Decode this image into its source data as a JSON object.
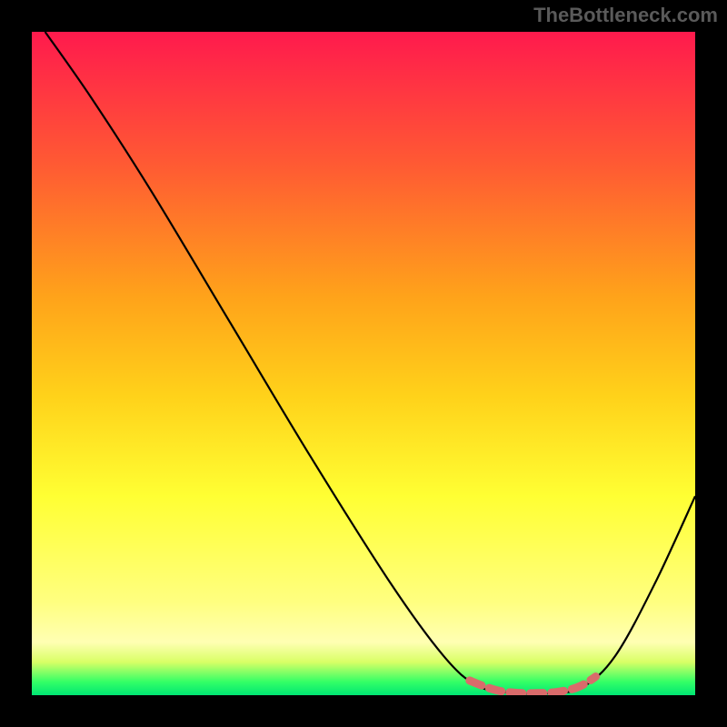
{
  "watermark": "TheBottleneck.com",
  "chart_data": {
    "type": "line",
    "title": "",
    "xlabel": "",
    "ylabel": "",
    "xlim": [
      0,
      100
    ],
    "ylim": [
      0,
      100
    ],
    "gradient_stops": [
      {
        "offset": 0,
        "color": "#ff1a4d"
      },
      {
        "offset": 20,
        "color": "#ff5a33"
      },
      {
        "offset": 40,
        "color": "#ffa31a"
      },
      {
        "offset": 55,
        "color": "#ffd21a"
      },
      {
        "offset": 70,
        "color": "#ffff33"
      },
      {
        "offset": 86,
        "color": "#ffff80"
      },
      {
        "offset": 92,
        "color": "#ffffb3"
      },
      {
        "offset": 95,
        "color": "#d9ff66"
      },
      {
        "offset": 98,
        "color": "#33ff66"
      },
      {
        "offset": 100,
        "color": "#00e673"
      }
    ],
    "series": [
      {
        "name": "bottleneck-curve",
        "color": "#000000",
        "points": [
          {
            "x": 2,
            "y": 100
          },
          {
            "x": 9,
            "y": 90
          },
          {
            "x": 18,
            "y": 76
          },
          {
            "x": 30,
            "y": 56
          },
          {
            "x": 42,
            "y": 36
          },
          {
            "x": 54,
            "y": 17
          },
          {
            "x": 62,
            "y": 6
          },
          {
            "x": 67,
            "y": 1.5
          },
          {
            "x": 72,
            "y": 0.4
          },
          {
            "x": 78,
            "y": 0.3
          },
          {
            "x": 83,
            "y": 1.2
          },
          {
            "x": 88,
            "y": 6
          },
          {
            "x": 94,
            "y": 17
          },
          {
            "x": 100,
            "y": 30
          }
        ]
      },
      {
        "name": "optimal-range-marker",
        "color": "#d96b6b",
        "points": [
          {
            "x": 66,
            "y": 2.2
          },
          {
            "x": 68,
            "y": 1.4
          },
          {
            "x": 69.5,
            "y": 0.9
          },
          {
            "x": 71,
            "y": 0.55
          },
          {
            "x": 73,
            "y": 0.35
          },
          {
            "x": 75,
            "y": 0.3
          },
          {
            "x": 77,
            "y": 0.32
          },
          {
            "x": 79,
            "y": 0.45
          },
          {
            "x": 80.5,
            "y": 0.7
          },
          {
            "x": 82,
            "y": 1.1
          },
          {
            "x": 83.5,
            "y": 1.8
          },
          {
            "x": 85,
            "y": 2.8
          }
        ]
      }
    ]
  }
}
